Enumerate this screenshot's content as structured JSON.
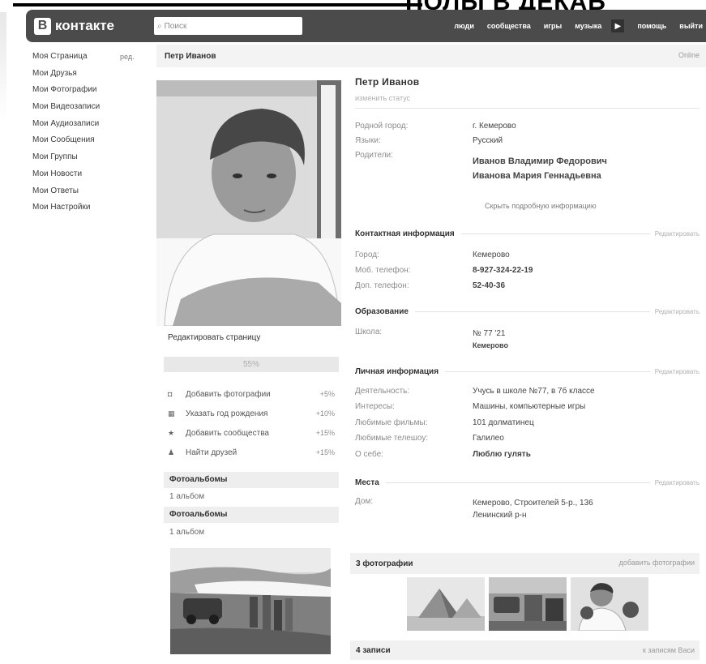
{
  "caption": "ПОЛЫ В ДЕКАБ",
  "header": {
    "logo_letter": "В",
    "logo_text": "контакте",
    "search_placeholder": "Поиск",
    "nav": [
      "люди",
      "сообщества",
      "игры",
      "музыка",
      "помощь",
      "выйти"
    ]
  },
  "menu": {
    "items": [
      "Моя Страница",
      "Мои Друзья",
      "Мои Фотографии",
      "Мои Видеозаписи",
      "Мои Аудиозаписи",
      "Мои Сообщения",
      "Мои Группы",
      "Мои Новости",
      "Мои Ответы",
      "Мои Настройки"
    ],
    "edit": "ред."
  },
  "profile": {
    "bar_title": "Петр Иванов",
    "online": "Online",
    "name": "Петр Иванов",
    "status": "изменить статус",
    "info": [
      {
        "k": "Родной город:",
        "v": "г. Кемерово"
      },
      {
        "k": "Языки:",
        "v": "Русский"
      },
      {
        "k": "Родители:",
        "v": ""
      }
    ],
    "parents": [
      "Иванов Владимир Федорович",
      "Иванова Мария Геннадьевна"
    ],
    "hide_details": "Скрыть подробную информацию",
    "edit": "Редактировать"
  },
  "contact": {
    "title": "Контактная информация",
    "rows": [
      {
        "k": "Город:",
        "v": "Кемерово"
      },
      {
        "k": "Моб. телефон:",
        "v": "8-927-324-22-19"
      },
      {
        "k": "Доп. телефон:",
        "v": "52-40-36"
      }
    ]
  },
  "education": {
    "title": "Образование",
    "school_label": "Школа:",
    "school": "№ 77 '21",
    "city": "Кемерово"
  },
  "personal": {
    "title": "Личная информация",
    "rows": [
      {
        "k": "Деятельность:",
        "v": "Учусь в школе №77, в 7б классе"
      },
      {
        "k": "Интересы:",
        "v": "Машины, компьютерные игры"
      },
      {
        "k": "Любимые фильмы:",
        "v": "101 долматинец"
      },
      {
        "k": "Любимые телешоу:",
        "v": "Галилео"
      },
      {
        "k": "О себе:",
        "v": "Люблю гулять"
      }
    ]
  },
  "places": {
    "title": "Места",
    "k": "Дом:",
    "lines": [
      "Кемерово, Строителей 5-р., 136",
      "Ленинский р-н"
    ]
  },
  "left_actions": {
    "edit_page": "Редактировать страницу",
    "progress": "55%",
    "progress_value": 55,
    "items": [
      {
        "icon": "camera-icon",
        "label": "Добавить фотографии",
        "pct": "+5%"
      },
      {
        "icon": "calendar-icon",
        "label": "Указать год рождения",
        "pct": "+10%"
      },
      {
        "icon": "star-icon",
        "label": "Добавить сообщества",
        "pct": "+15%"
      },
      {
        "icon": "people-icon",
        "label": "Найти друзей",
        "pct": "+15%"
      }
    ]
  },
  "albums": [
    {
      "title": "Фотоальбомы",
      "count": "1 альбом"
    },
    {
      "title": "Фотоальбомы",
      "count": "1 альбом"
    }
  ],
  "photos": {
    "title": "3 фотографии",
    "add": "добавить фотографии"
  },
  "wall": {
    "title": "4 записи",
    "link": "к записям Васи"
  }
}
